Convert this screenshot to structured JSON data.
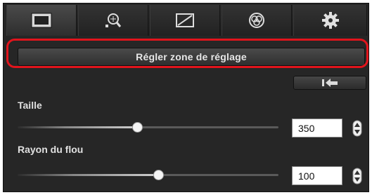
{
  "tabs": [
    {
      "name": "basic-image-tab",
      "icon": "image-frame-icon",
      "active": true
    },
    {
      "name": "sharpness-tab",
      "icon": "magnifier-grid-icon",
      "active": false
    },
    {
      "name": "tone-curve-tab",
      "icon": "tone-curve-icon",
      "active": false
    },
    {
      "name": "color-tab",
      "icon": "color-circles-icon",
      "active": false
    },
    {
      "name": "settings-tab",
      "icon": "gear-icon",
      "active": false
    }
  ],
  "adjust_button": {
    "label": "Régler zone de réglage"
  },
  "reset_button": {
    "icon": "undo-reset-icon"
  },
  "size": {
    "label": "Taille",
    "value": "350",
    "level": 0.45
  },
  "blur": {
    "label": "Rayon du flou",
    "value": "100",
    "level": 0.55
  },
  "colors": {
    "highlight": "#e2141c",
    "panel": "#262626"
  }
}
